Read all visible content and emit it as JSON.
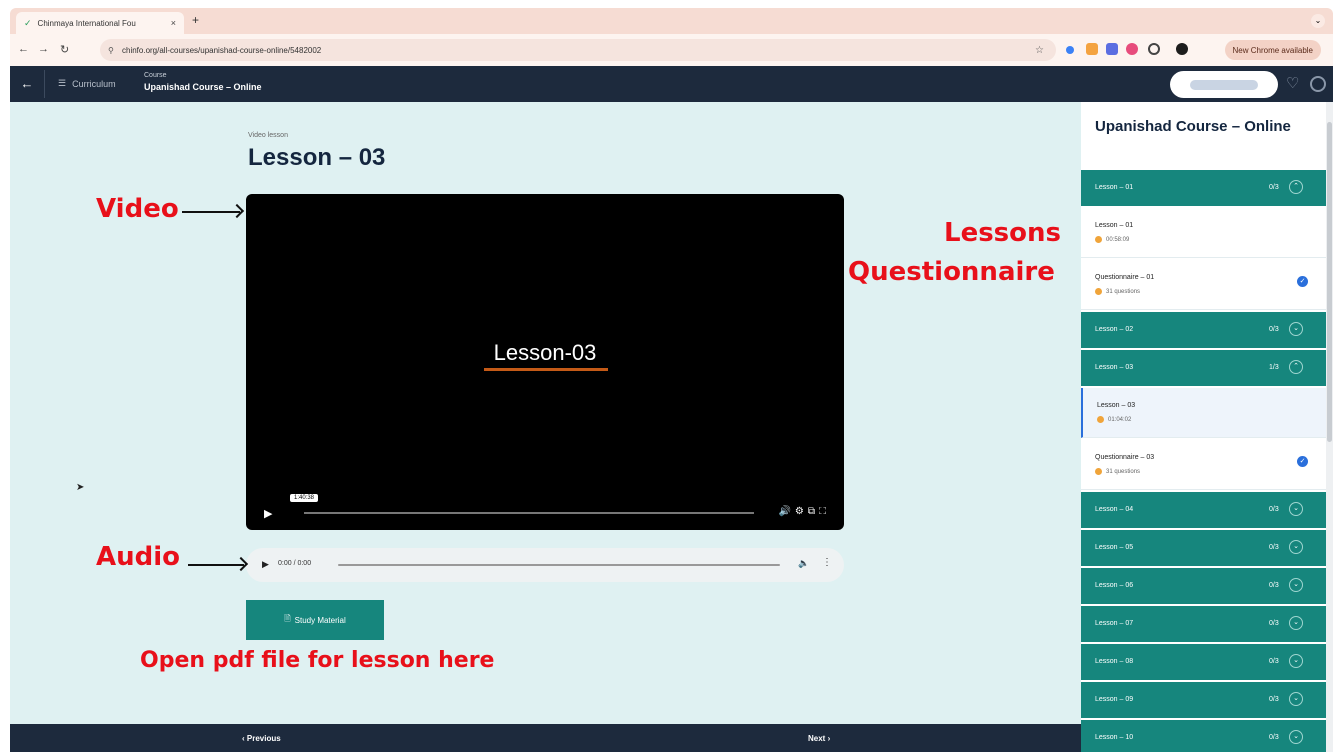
{
  "browser": {
    "tab_title": "Chinmaya International Fou",
    "tab_close": "×",
    "new_tab": "+",
    "url": "chinfo.org/all-courses/upanishad-course-online/5482002",
    "new_chrome_label": "New Chrome available"
  },
  "app": {
    "back": "←",
    "curriculum_label": "Curriculum",
    "course_key": "Course",
    "course_name": "Upanishad Course – Online"
  },
  "main": {
    "video_label": "Video lesson",
    "lesson_title": "Lesson – 03",
    "video_overlay_title": "Lesson-03",
    "video_time_badge": "1:40:38",
    "audio_time": "0:00 / 0:00",
    "study_button": "Study Material"
  },
  "annotations": {
    "video": "Video",
    "audio": "Audio",
    "lessons": "Lessons",
    "questionnaire": "Questionnaire",
    "pdf": "Open pdf file for lesson here"
  },
  "footer": {
    "previous": "‹ Previous",
    "next": "Next ›"
  },
  "sidebar": {
    "title": "Upanishad Course – Online",
    "rows": [
      {
        "kind": "section",
        "label": "Lesson – 01",
        "count": "0/3",
        "icon": "⌃"
      },
      {
        "kind": "item",
        "label": "Lesson – 01",
        "meta": "00:58:09",
        "done": false,
        "active": false
      },
      {
        "kind": "item",
        "label": "Questionnaire – 01",
        "meta": "31 questions",
        "done": true,
        "active": false
      },
      {
        "kind": "section",
        "label": "Lesson – 02",
        "count": "0/3",
        "icon": "⌄"
      },
      {
        "kind": "section",
        "label": "Lesson – 03",
        "count": "1/3",
        "icon": "⌃"
      },
      {
        "kind": "item",
        "label": "Lesson – 03",
        "meta": "01:04:02",
        "done": false,
        "active": true
      },
      {
        "kind": "item",
        "label": "Questionnaire – 03",
        "meta": "31 questions",
        "done": true,
        "active": false
      },
      {
        "kind": "section",
        "label": "Lesson – 04",
        "count": "0/3",
        "icon": "⌄"
      },
      {
        "kind": "section",
        "label": "Lesson – 05",
        "count": "0/3",
        "icon": "⌄"
      },
      {
        "kind": "section",
        "label": "Lesson – 06",
        "count": "0/3",
        "icon": "⌄"
      },
      {
        "kind": "section",
        "label": "Lesson – 07",
        "count": "0/3",
        "icon": "⌄"
      },
      {
        "kind": "section",
        "label": "Lesson – 08",
        "count": "0/3",
        "icon": "⌄"
      },
      {
        "kind": "section",
        "label": "Lesson – 09",
        "count": "0/3",
        "icon": "⌄"
      },
      {
        "kind": "section",
        "label": "Lesson – 10",
        "count": "0/3",
        "icon": "⌄"
      }
    ]
  }
}
